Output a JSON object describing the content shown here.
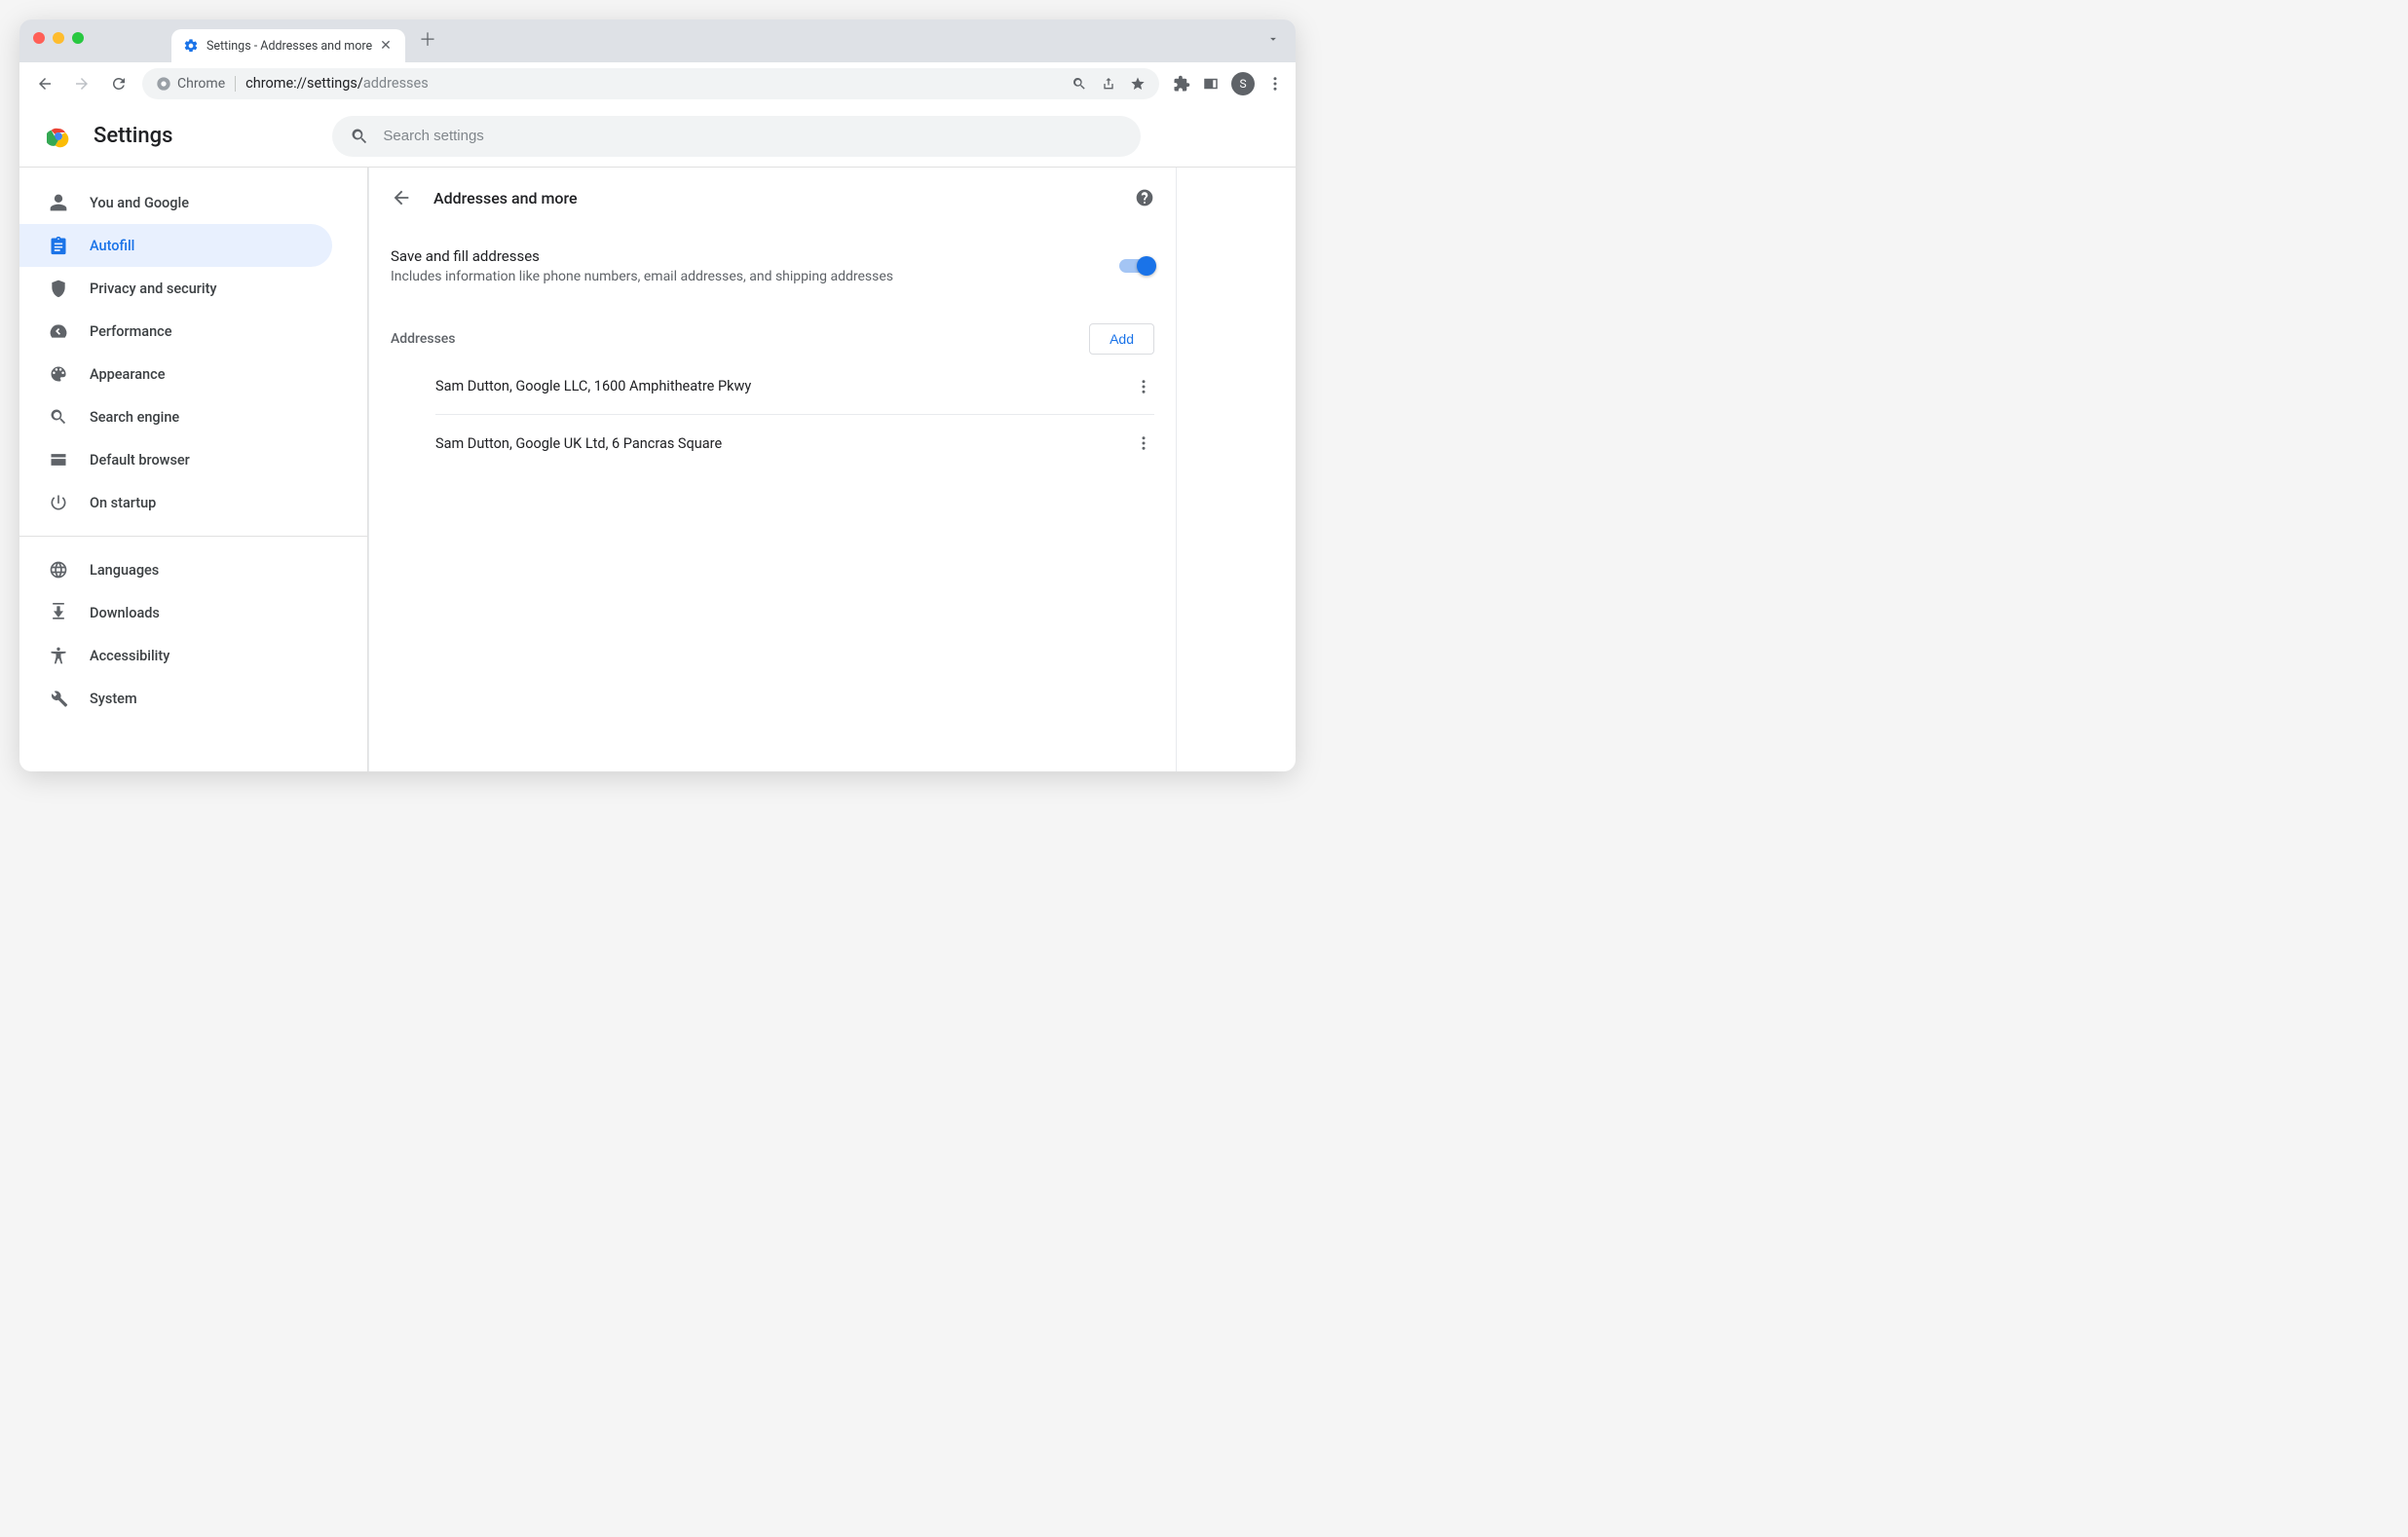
{
  "window": {
    "tab_title": "Settings - Addresses and more",
    "omnibox_prefix": "Chrome",
    "omnibox_url_strong": "chrome://",
    "omnibox_url_mid": "settings/",
    "omnibox_url_faded": "addresses",
    "avatar_initial": "S"
  },
  "header": {
    "app_title": "Settings",
    "search_placeholder": "Search settings"
  },
  "sidebar": {
    "items": [
      {
        "label": "You and Google"
      },
      {
        "label": "Autofill"
      },
      {
        "label": "Privacy and security"
      },
      {
        "label": "Performance"
      },
      {
        "label": "Appearance"
      },
      {
        "label": "Search engine"
      },
      {
        "label": "Default browser"
      },
      {
        "label": "On startup"
      }
    ],
    "items2": [
      {
        "label": "Languages"
      },
      {
        "label": "Downloads"
      },
      {
        "label": "Accessibility"
      },
      {
        "label": "System"
      }
    ]
  },
  "panel": {
    "title": "Addresses and more",
    "toggle_title": "Save and fill addresses",
    "toggle_sub": "Includes information like phone numbers, email addresses, and shipping addresses",
    "addresses_label": "Addresses",
    "add_label": "Add",
    "addresses": [
      "Sam Dutton, Google LLC, 1600 Amphitheatre Pkwy",
      "Sam Dutton, Google UK Ltd, 6 Pancras Square"
    ]
  }
}
